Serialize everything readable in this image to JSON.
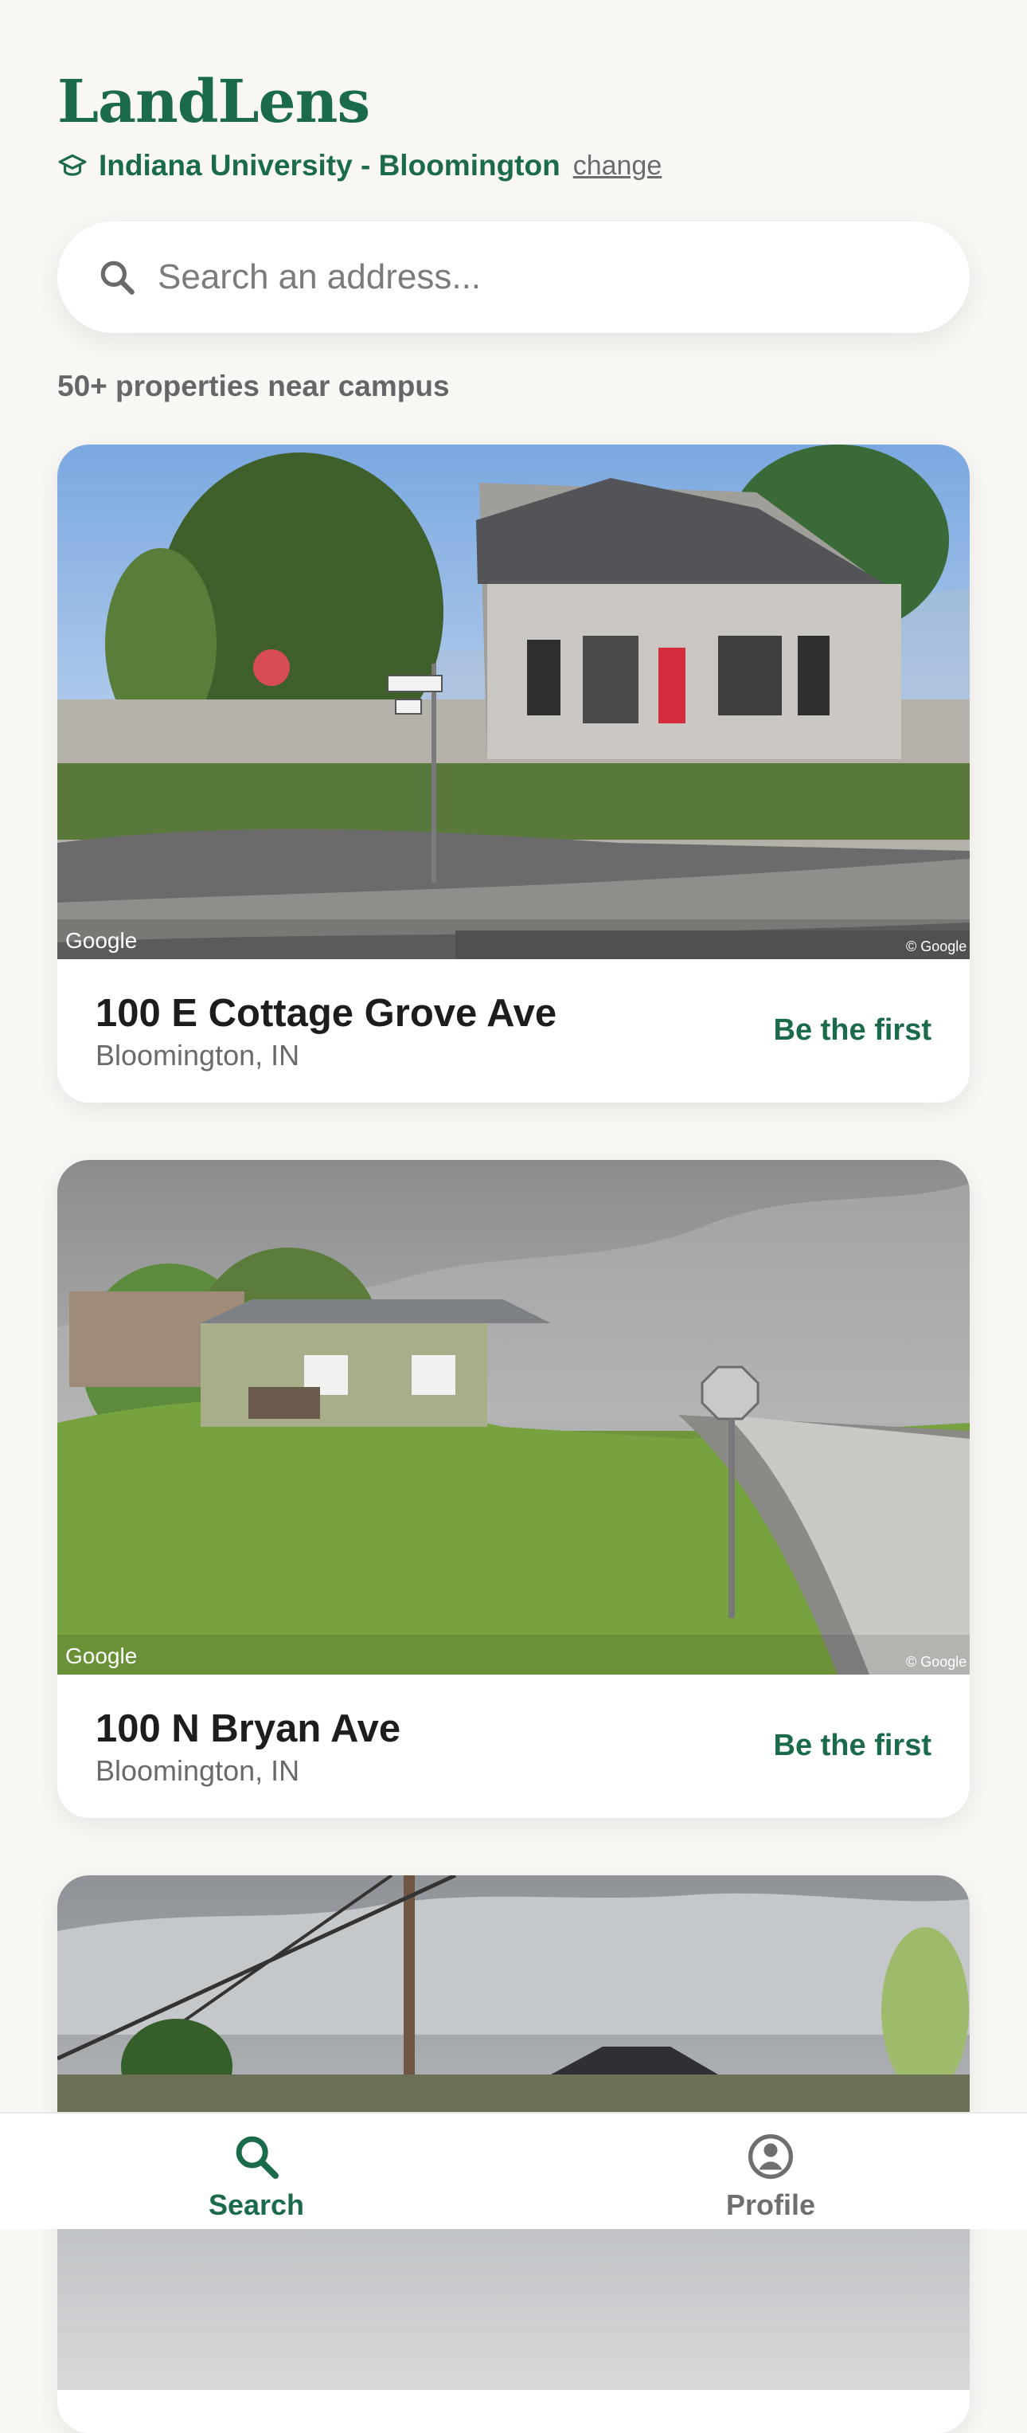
{
  "app": {
    "brand": "LandLens",
    "school": "Indiana University - Bloomington",
    "change_label": "change"
  },
  "search": {
    "placeholder": "Search an address..."
  },
  "results": {
    "count_label": "50+ properties near campus"
  },
  "listings": [
    {
      "address": "100 E Cottage Grove Ave",
      "city": "Bloomington, IN",
      "status": "Be the first"
    },
    {
      "address": "100 N Bryan Ave",
      "city": "Bloomington, IN",
      "status": "Be the first"
    }
  ],
  "nav": {
    "search_label": "Search",
    "profile_label": "Profile"
  },
  "colors": {
    "brand": "#1b6b4b",
    "background": "#f8f7f4"
  },
  "icons": {
    "school": "graduation-cap-icon",
    "search": "search-icon",
    "profile": "user-circle-icon"
  }
}
